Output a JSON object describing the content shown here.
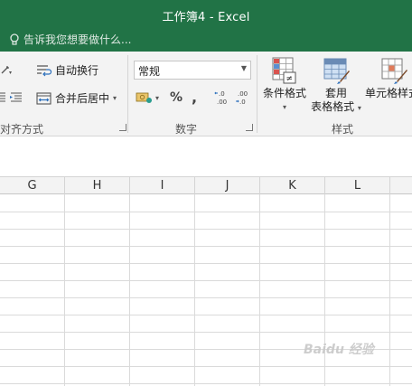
{
  "window": {
    "title": "工作簿4 - Excel",
    "tell_me_placeholder": "告诉我您想要做什么..."
  },
  "ribbon": {
    "alignment": {
      "wrap_text_label": "自动换行",
      "merge_center_label": "合并后居中",
      "group_label": "对齐方式"
    },
    "number": {
      "format_selected": "常规",
      "percent_label": "%",
      "comma_label": ",",
      "increase_decimal_label": "←.0\n.00",
      "decrease_decimal_label": ".00\n→.0",
      "group_label": "数字"
    },
    "styles": {
      "conditional_formatting_label": "条件格式",
      "format_as_table_line1": "套用",
      "format_as_table_line2": "表格格式",
      "cell_styles_label": "单元格样式",
      "group_label": "样式"
    }
  },
  "grid": {
    "columns": [
      "G",
      "H",
      "I",
      "J",
      "K",
      "L"
    ]
  },
  "watermark": "Baidu 经验",
  "colors": {
    "title_bar": "#217346",
    "ribbon_bg": "#f3f3f3",
    "gridline": "#dadada"
  }
}
